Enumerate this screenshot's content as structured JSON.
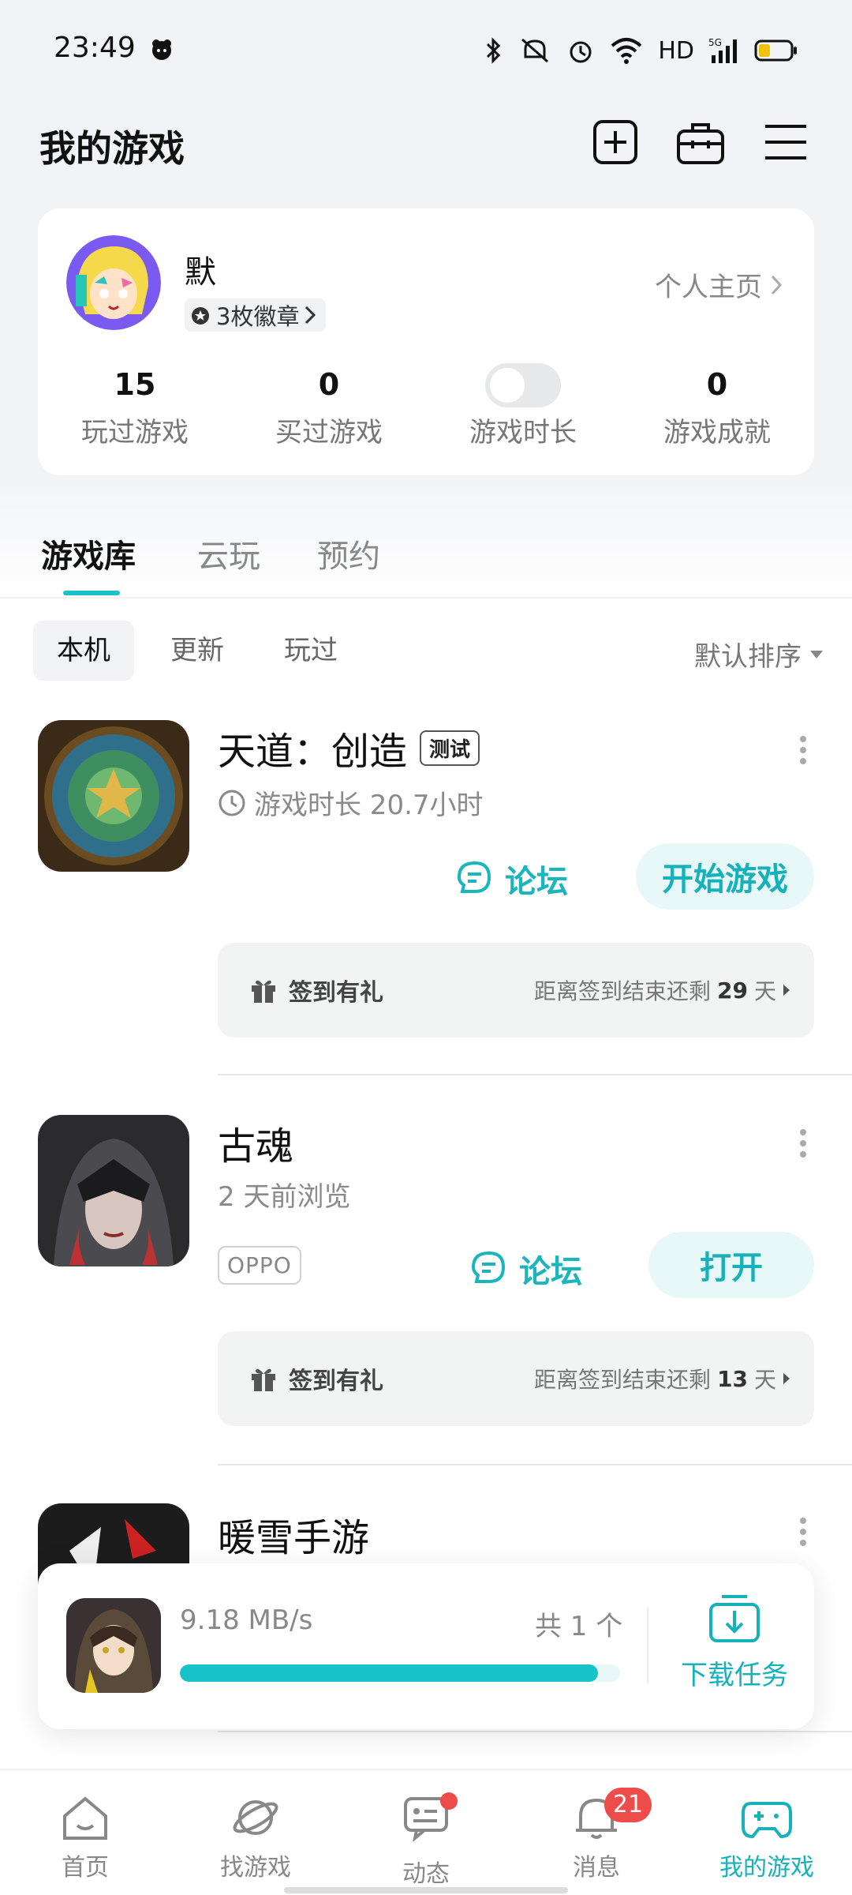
{
  "status_bar": {
    "time": "23:49",
    "network": "HD"
  },
  "header": {
    "title": "我的游戏"
  },
  "profile": {
    "username": "默",
    "badges": "3枚徽章",
    "profile_link": "个人主页",
    "stats": [
      {
        "value": "15",
        "label": "玩过游戏"
      },
      {
        "value": "0",
        "label": "买过游戏"
      },
      {
        "value": "",
        "label": "游戏时长"
      },
      {
        "value": "0",
        "label": "游戏成就"
      }
    ]
  },
  "tabs": [
    {
      "label": "游戏库"
    },
    {
      "label": "云玩"
    },
    {
      "label": "预约"
    }
  ],
  "filters": [
    {
      "label": "本机"
    },
    {
      "label": "更新"
    },
    {
      "label": "玩过"
    }
  ],
  "sort_label": "默认排序",
  "games": [
    {
      "name": "天道：创造",
      "tag": "测试",
      "subtitle": "游戏时长 20.7小时",
      "forum_label": "论坛",
      "action_label": "开始游戏",
      "signin_label": "签到有礼",
      "signin_prefix": "距离签到结束还剩",
      "signin_days": "29",
      "signin_suffix": "天"
    },
    {
      "name": "古魂",
      "subtitle": "2 天前浏览",
      "store_tag": "OPPO",
      "forum_label": "论坛",
      "action_label": "打开",
      "signin_label": "签到有礼",
      "signin_prefix": "距离签到结束还剩",
      "signin_days": "13",
      "signin_suffix": "天"
    },
    {
      "name": "暖雪手游"
    }
  ],
  "download": {
    "speed": "9.18 MB/s",
    "count": "共 1 个",
    "progress": 0.95,
    "task_label": "下载任务"
  },
  "bottom_nav": [
    {
      "label": "首页"
    },
    {
      "label": "找游戏"
    },
    {
      "label": "动态"
    },
    {
      "label": "消息",
      "badge": "21"
    },
    {
      "label": "我的游戏"
    }
  ],
  "colors": {
    "accent": "#17b1ba",
    "badge_red": "#ee4b4b"
  }
}
